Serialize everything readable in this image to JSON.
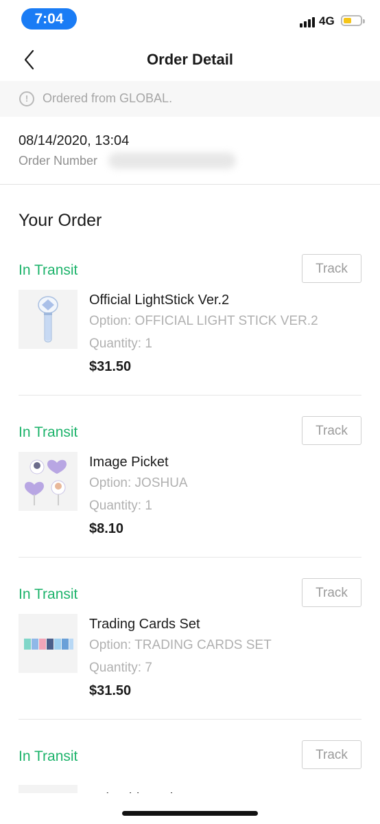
{
  "status_bar": {
    "time": "7:04",
    "network": "4G"
  },
  "header": {
    "title": "Order Detail"
  },
  "notice": {
    "text": "Ordered from GLOBAL."
  },
  "order": {
    "date": "08/14/2020, 13:04",
    "number_label": "Order Number"
  },
  "section_title": "Your Order",
  "items": [
    {
      "status": "In Transit",
      "track_label": "Track",
      "name": "Official LightStick Ver.2",
      "option": "Option: OFFICIAL LIGHT STICK VER.2",
      "quantity": "Quantity: 1",
      "price": "$31.50"
    },
    {
      "status": "In Transit",
      "track_label": "Track",
      "name": "Image Picket",
      "option": "Option: JOSHUA",
      "quantity": "Quantity: 1",
      "price": "$8.10"
    },
    {
      "status": "In Transit",
      "track_label": "Track",
      "name": "Trading Cards Set",
      "option": "Option: TRADING CARDS SET",
      "quantity": "Quantity: 7",
      "price": "$31.50"
    },
    {
      "status": "In Transit",
      "track_label": "Track",
      "name": "Polaroid Card Set"
    }
  ],
  "colors": {
    "accent_green": "#1db36b",
    "time_pill_blue": "#1a7cf5"
  }
}
